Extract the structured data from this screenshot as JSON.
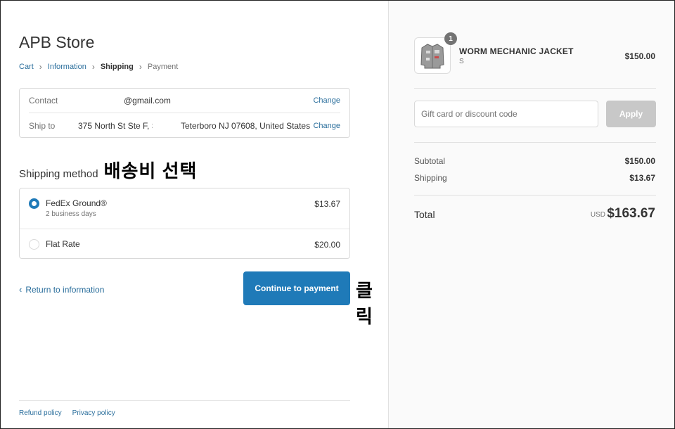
{
  "store": {
    "title": "APB Store"
  },
  "breadcrumb": {
    "items": [
      "Cart",
      "Information",
      "Shipping",
      "Payment"
    ]
  },
  "review": {
    "contact_label": "Contact",
    "contact_value": "@gmail.com",
    "shipto_label": "Ship to",
    "shipto_value_part1": "375 North St Ste F, S",
    "shipto_value_part2": "Teterboro NJ 07608, United States",
    "change_label": "Change"
  },
  "shipping": {
    "heading": "Shipping method",
    "annotation": "배송비 선택",
    "options": [
      {
        "name": "FedEx Ground®",
        "sub": "2 business days",
        "price": "$13.67",
        "selected": true
      },
      {
        "name": "Flat Rate",
        "sub": "",
        "price": "$20.00",
        "selected": false
      }
    ]
  },
  "actions": {
    "return_label": "Return to information",
    "continue_label": "Continue to payment",
    "click_annotation": "클릭"
  },
  "footer": {
    "links": [
      "Refund policy",
      "Privacy policy"
    ]
  },
  "summary": {
    "item": {
      "name": "WORM MECHANIC JACKET",
      "variant": "S",
      "price": "$150.00",
      "quantity": "1"
    },
    "discount_placeholder": "Gift card or discount code",
    "apply_label": "Apply",
    "subtotal_label": "Subtotal",
    "subtotal_value": "$150.00",
    "shipping_label": "Shipping",
    "shipping_value": "$13.67",
    "total_label": "Total",
    "total_currency": "USD",
    "total_value": "$163.67"
  },
  "colors": {
    "accent": "#1f7ab8",
    "link": "#2a6e9c",
    "panel_bg": "#fafafa"
  }
}
